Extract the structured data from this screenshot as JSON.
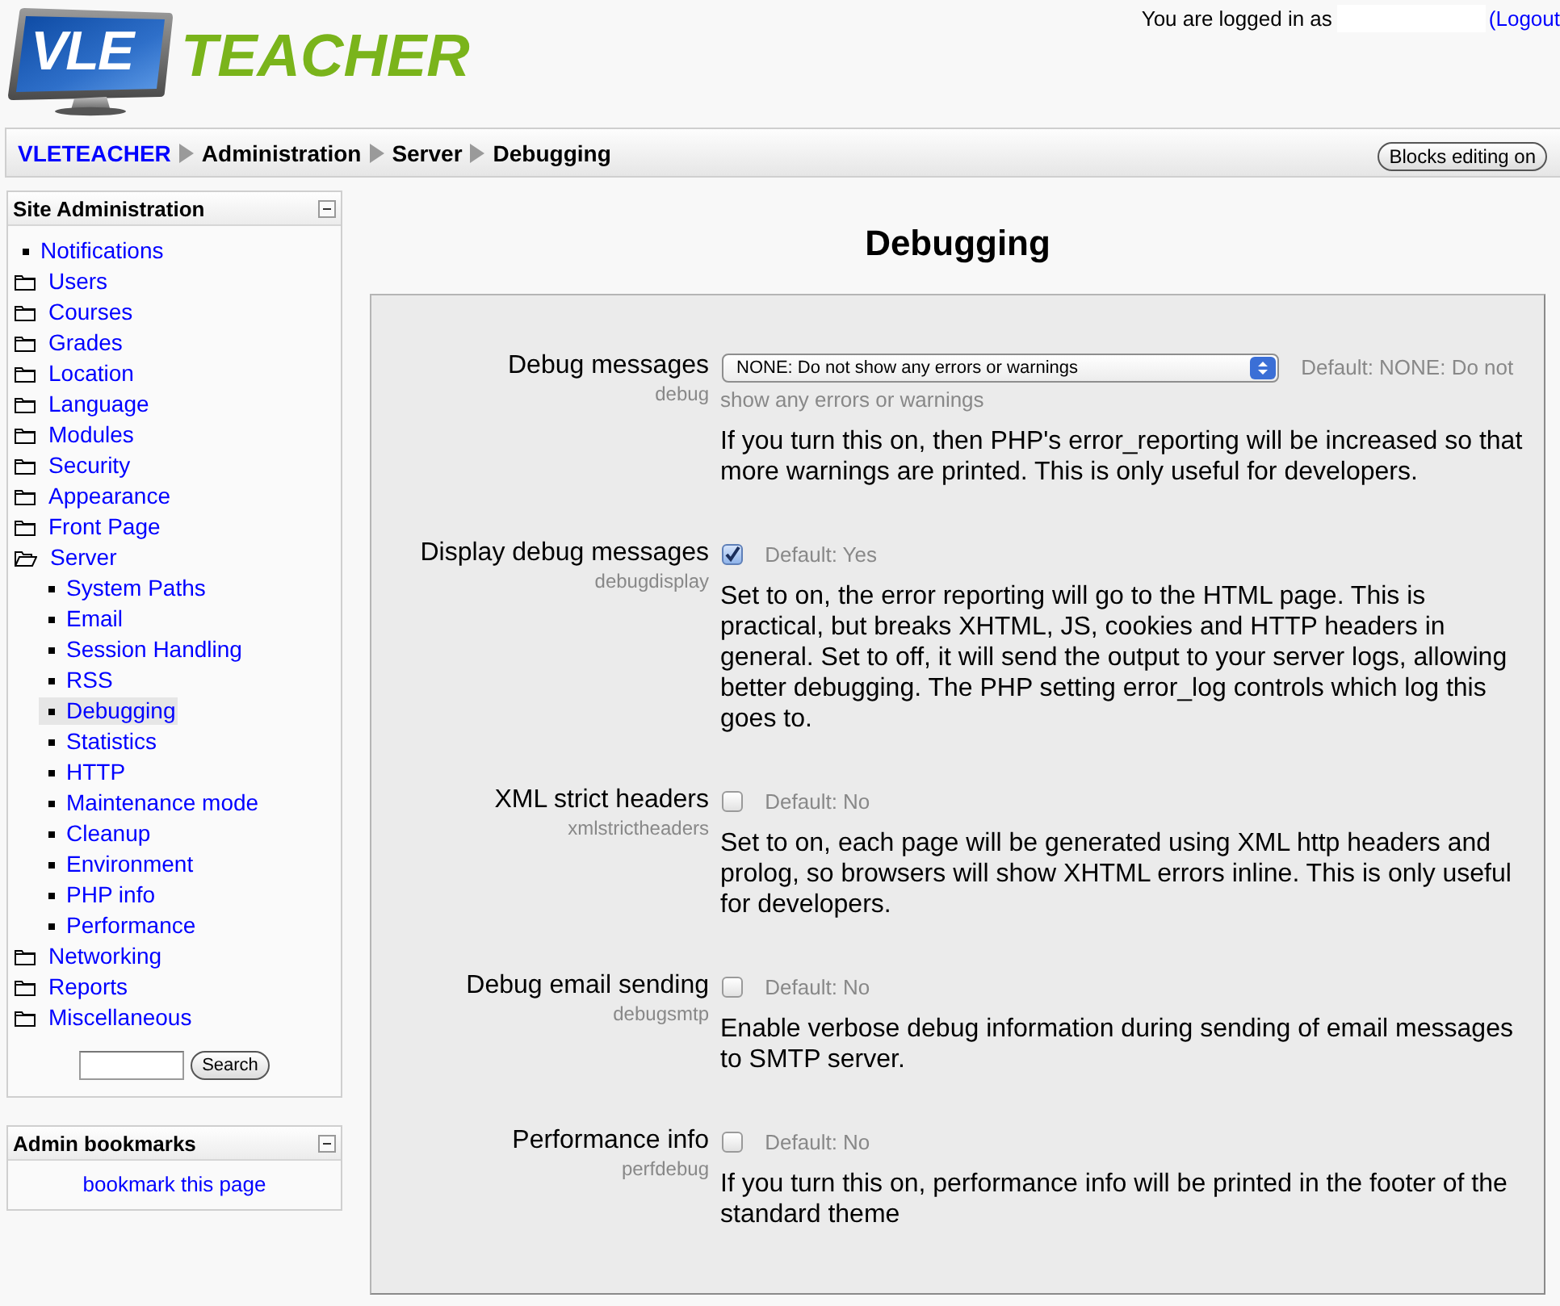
{
  "header": {
    "logo": {
      "screen_text": "VLE",
      "wordmark": "TEACHER"
    },
    "login": {
      "text": "You are logged in as",
      "logout": "(Logout"
    }
  },
  "breadcrumb": {
    "items": [
      {
        "label": "VLETEACHER",
        "kind": "link"
      },
      {
        "label": "Administration",
        "kind": "text"
      },
      {
        "label": "Server",
        "kind": "text"
      },
      {
        "label": "Debugging",
        "kind": "text"
      }
    ],
    "button": "Blocks editing on"
  },
  "sidebar": {
    "site_admin": {
      "title": "Site Administration",
      "items": [
        {
          "kind": "page",
          "label": "Notifications",
          "selected": false
        },
        {
          "kind": "folder",
          "label": "Users",
          "selected": false,
          "expanded": false
        },
        {
          "kind": "folder",
          "label": "Courses",
          "selected": false,
          "expanded": false
        },
        {
          "kind": "folder",
          "label": "Grades",
          "selected": false,
          "expanded": false
        },
        {
          "kind": "folder",
          "label": "Location",
          "selected": false,
          "expanded": false
        },
        {
          "kind": "folder",
          "label": "Language",
          "selected": false,
          "expanded": false
        },
        {
          "kind": "folder",
          "label": "Modules",
          "selected": false,
          "expanded": false
        },
        {
          "kind": "folder",
          "label": "Security",
          "selected": false,
          "expanded": false
        },
        {
          "kind": "folder",
          "label": "Appearance",
          "selected": false,
          "expanded": false
        },
        {
          "kind": "folder",
          "label": "Front Page",
          "selected": false,
          "expanded": false
        },
        {
          "kind": "folder",
          "label": "Server",
          "selected": false,
          "expanded": true,
          "children": [
            {
              "kind": "page",
              "label": "System Paths",
              "selected": false
            },
            {
              "kind": "page",
              "label": "Email",
              "selected": false
            },
            {
              "kind": "page",
              "label": "Session Handling",
              "selected": false
            },
            {
              "kind": "page",
              "label": "RSS",
              "selected": false
            },
            {
              "kind": "page",
              "label": "Debugging",
              "selected": true
            },
            {
              "kind": "page",
              "label": "Statistics",
              "selected": false
            },
            {
              "kind": "page",
              "label": "HTTP",
              "selected": false
            },
            {
              "kind": "page",
              "label": "Maintenance mode",
              "selected": false
            },
            {
              "kind": "page",
              "label": "Cleanup",
              "selected": false
            },
            {
              "kind": "page",
              "label": "Environment",
              "selected": false
            },
            {
              "kind": "page",
              "label": "PHP info",
              "selected": false
            },
            {
              "kind": "page",
              "label": "Performance",
              "selected": false
            }
          ]
        },
        {
          "kind": "folder",
          "label": "Networking",
          "selected": false,
          "expanded": false
        },
        {
          "kind": "folder",
          "label": "Reports",
          "selected": false,
          "expanded": false
        },
        {
          "kind": "folder",
          "label": "Miscellaneous",
          "selected": false,
          "expanded": false
        }
      ],
      "search_button": "Search"
    },
    "bookmarks": {
      "title": "Admin bookmarks",
      "link": "bookmark this page"
    }
  },
  "main": {
    "heading": "Debugging",
    "settings": [
      {
        "kind": "select",
        "label": "Debug messages",
        "name": "debug",
        "value": "NONE: Do not show any errors or warnings",
        "default_lines": [
          "Default: NONE: Do not",
          "show any errors or warnings"
        ],
        "description": "If you turn this on, then PHP's error_reporting will be increased so that more warnings are printed. This is only useful for developers."
      },
      {
        "kind": "checkbox",
        "label": "Display debug messages",
        "name": "debugdisplay",
        "checked": true,
        "default_lines": [
          "Default: Yes"
        ],
        "description": "Set to on, the error reporting will go to the HTML page. This is practical, but breaks XHTML, JS, cookies and HTTP headers in general. Set to off, it will send the output to your server logs, allowing better debugging. The PHP setting error_log controls which log this goes to."
      },
      {
        "kind": "checkbox",
        "label": "XML strict headers",
        "name": "xmlstrictheaders",
        "checked": false,
        "default_lines": [
          "Default: No"
        ],
        "description": "Set to on, each page will be generated using XML http headers and prolog, so browsers will show XHTML errors inline. This is only useful for developers."
      },
      {
        "kind": "checkbox",
        "label": "Debug email sending",
        "name": "debugsmtp",
        "checked": false,
        "default_lines": [
          "Default: No"
        ],
        "description": "Enable verbose debug information during sending of email messages to SMTP server."
      },
      {
        "kind": "checkbox",
        "label": "Performance info",
        "name": "perfdebug",
        "checked": false,
        "default_lines": [
          "Default: No"
        ],
        "description": "If you turn this on, performance info will be printed in the footer of the standard theme"
      }
    ]
  }
}
